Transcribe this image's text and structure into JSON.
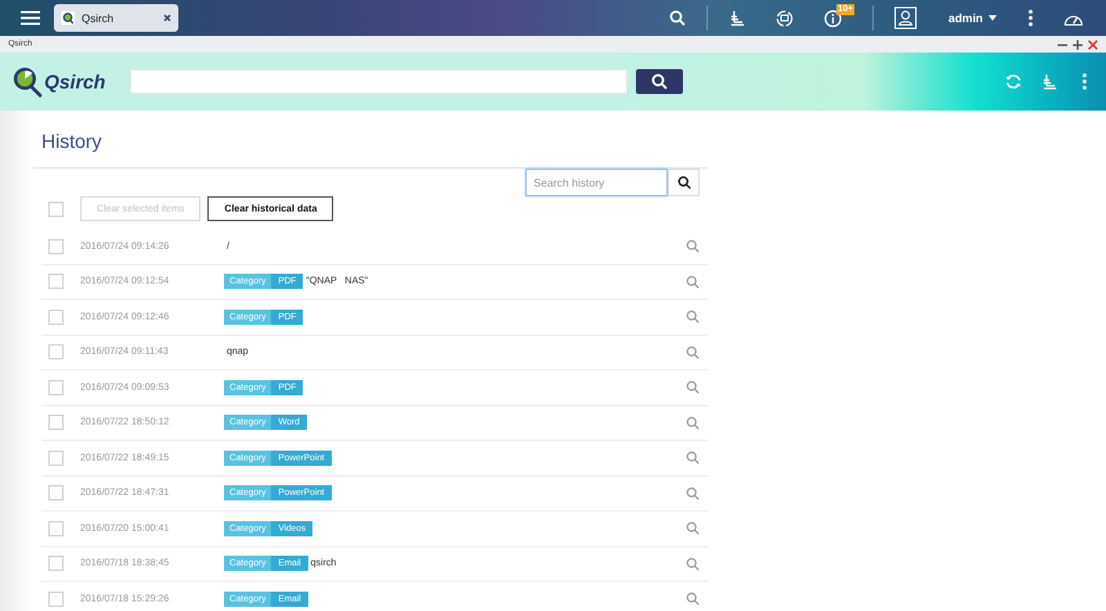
{
  "taskbar": {
    "tab": {
      "label": "Qsirch",
      "selected": true
    },
    "badge": "10+",
    "user": "admin"
  },
  "window": {
    "title": "Qsirch"
  },
  "header": {
    "logo": "Qsirch"
  },
  "page": {
    "title": "History"
  },
  "toolbar": {
    "select_all": {
      "checked": false
    },
    "buttons": [
      {
        "label": "Clear selected items",
        "disabled": true
      },
      {
        "label": "Clear historical data",
        "disabled": false
      }
    ],
    "search": {
      "placeholder": "Search history"
    }
  },
  "rows": [
    {
      "checked": false,
      "time": "2016/07/24 09:14:26",
      "query": "/"
    },
    {
      "checked": false,
      "time": "2016/07/24 09:12:54",
      "tag": {
        "label": "Category",
        "value": "PDF"
      },
      "query": "\"QNAP   NAS\""
    },
    {
      "checked": false,
      "time": "2016/07/24 09:12:46",
      "tag": {
        "label": "Category",
        "value": "PDF"
      }
    },
    {
      "checked": false,
      "time": "2016/07/24 09:11:43",
      "query": "qnap"
    },
    {
      "checked": false,
      "time": "2016/07/24 09:09:53",
      "tag": {
        "label": "Category",
        "value": "PDF"
      }
    },
    {
      "checked": false,
      "time": "2016/07/22 18:50:12",
      "tag": {
        "label": "Category",
        "value": "Word"
      }
    },
    {
      "checked": false,
      "time": "2016/07/22 18:49:15",
      "tag": {
        "label": "Category",
        "value": "PowerPoint"
      }
    },
    {
      "checked": false,
      "time": "2016/07/22 18:47:31",
      "tag": {
        "label": "Category",
        "value": "PowerPoint"
      }
    },
    {
      "checked": false,
      "time": "2016/07/20 15:00:41",
      "tag": {
        "label": "Category",
        "value": "Videos"
      }
    },
    {
      "checked": false,
      "time": "2016/07/18 18:38:45",
      "tag": {
        "label": "Category",
        "value": "Email"
      },
      "query": "qsirch"
    },
    {
      "checked": false,
      "time": "2016/07/18 15:29:26",
      "tag": {
        "label": "Category",
        "value": "Email"
      }
    }
  ]
}
